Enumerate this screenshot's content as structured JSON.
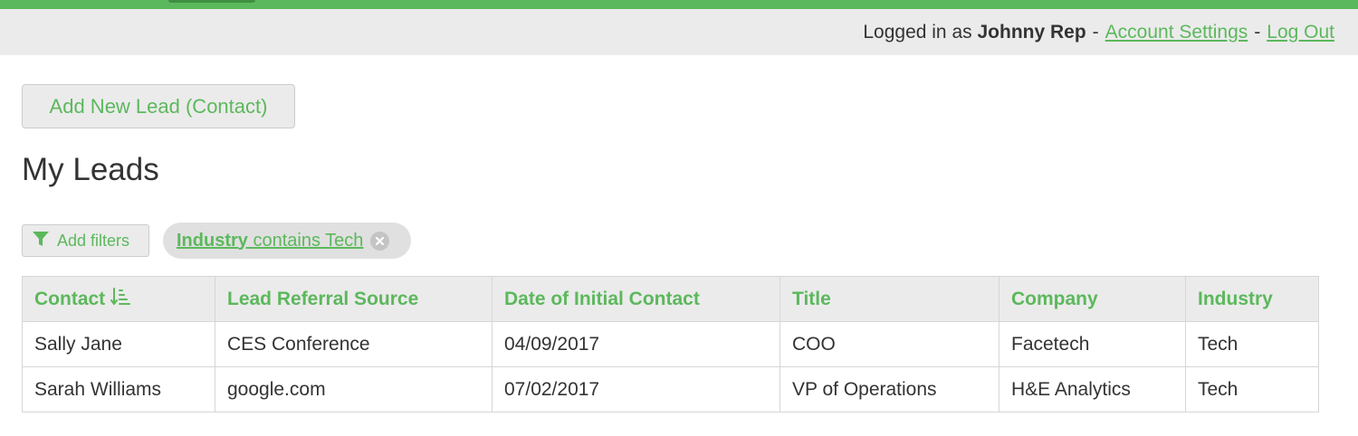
{
  "userbar": {
    "logged_in_prefix": "Logged in as",
    "user_name": "Johnny Rep",
    "separator": "-",
    "account_settings": "Account Settings",
    "log_out": "Log Out"
  },
  "actions": {
    "add_lead_label": "Add New Lead (Contact)"
  },
  "page": {
    "title": "My Leads"
  },
  "filters": {
    "add_filters_label": "Add filters",
    "active": [
      {
        "field": "Industry",
        "operator": "contains Tech"
      }
    ]
  },
  "table": {
    "columns": [
      "Contact",
      "Lead Referral Source",
      "Date of Initial Contact",
      "Title",
      "Company",
      "Industry"
    ],
    "sorted_column": "Contact",
    "rows": [
      [
        "Sally Jane",
        "CES Conference",
        "04/09/2017",
        "COO",
        "Facetech",
        "Tech"
      ],
      [
        "Sarah Williams",
        "google.com",
        "07/02/2017",
        "VP of Operations",
        "H&E Analytics",
        "Tech"
      ]
    ]
  },
  "colors": {
    "accent": "#5cb85c",
    "header_bg": "#ebebeb",
    "text": "#333333"
  },
  "icons": {
    "filter": "filter-funnel-icon",
    "sort": "sort-ascending-icon",
    "remove": "close-circle-icon"
  }
}
